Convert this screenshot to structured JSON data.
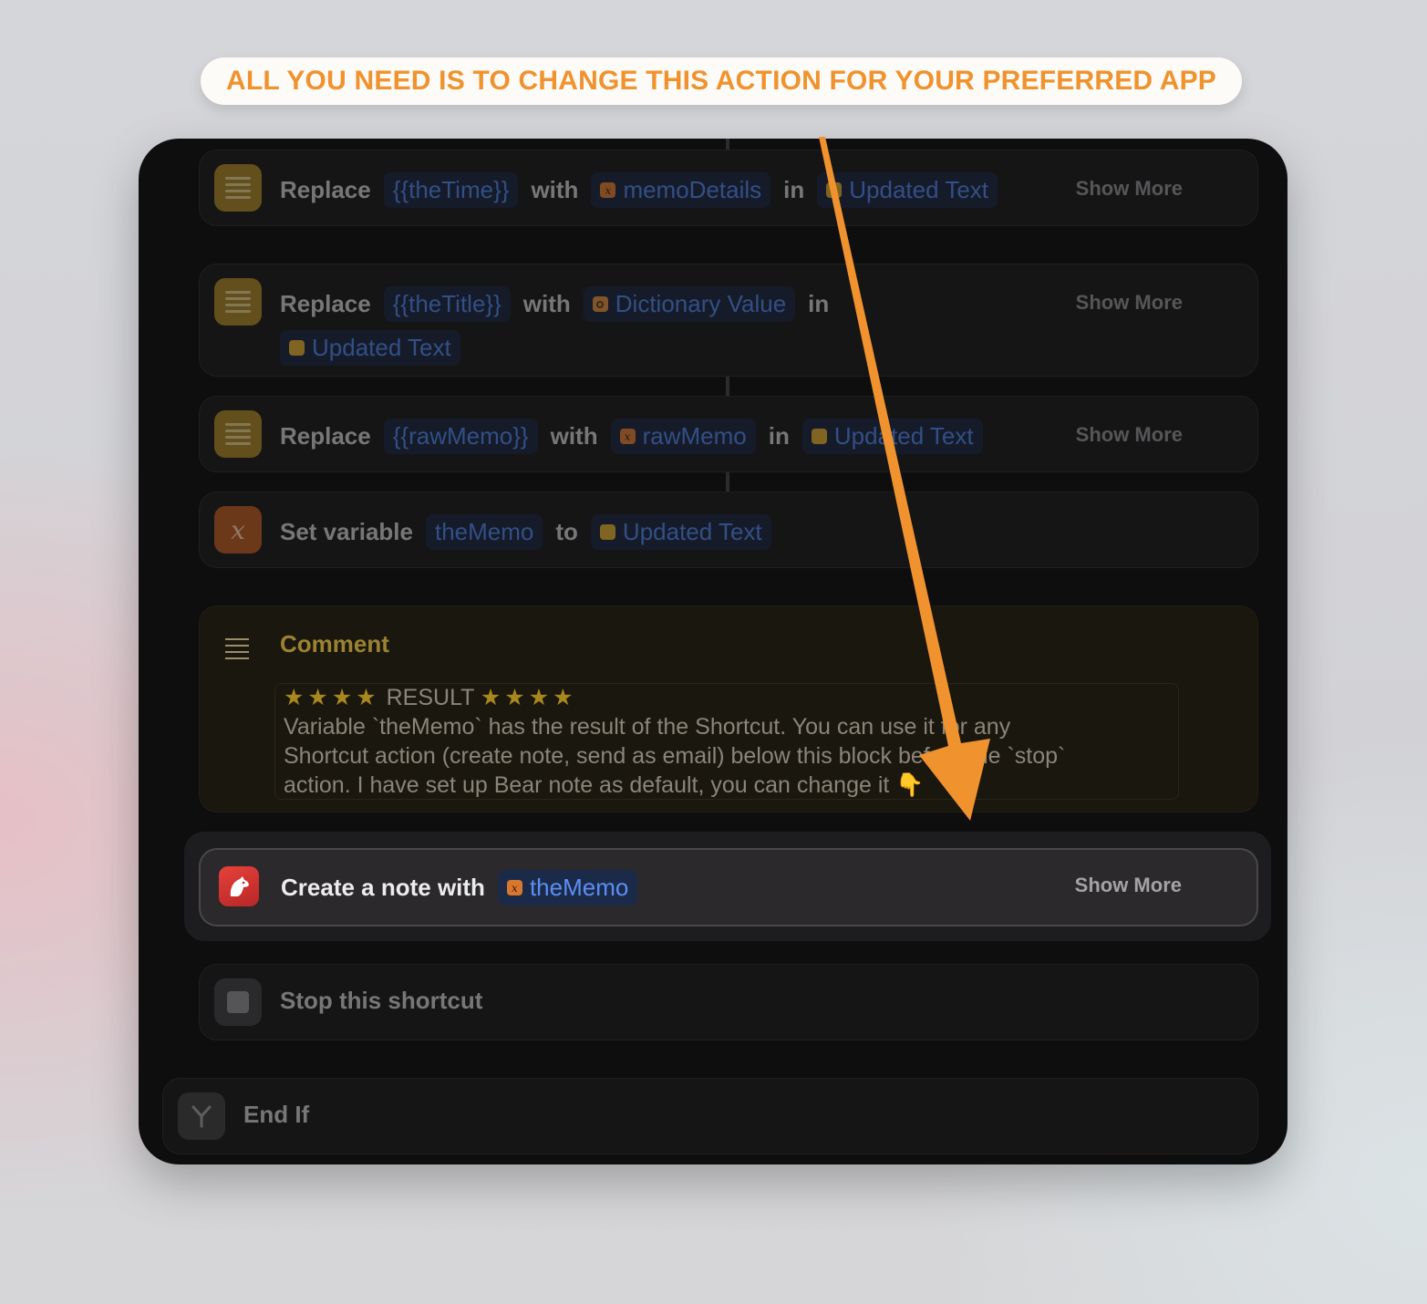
{
  "banner": {
    "text": "ALL YOU NEED IS TO CHANGE THIS ACTION FOR YOUR PREFERRED APP"
  },
  "actions": [
    {
      "verb": "Replace",
      "find": "{{theTime}}",
      "with": "with",
      "value": "memoDetails",
      "in": "in",
      "target": "Updated Text",
      "show_more": "Show More"
    },
    {
      "verb": "Replace",
      "find": "{{theTitle}}",
      "with": "with",
      "value": "Dictionary Value",
      "in": "in",
      "target": "Updated Text",
      "show_more": "Show More"
    },
    {
      "verb": "Replace",
      "find": "{{rawMemo}}",
      "with": "with",
      "value": "rawMemo",
      "in": "in",
      "target": "Updated Text",
      "show_more": "Show More"
    },
    {
      "verb": "Set variable",
      "variable": "theMemo",
      "to": "to",
      "target": "Updated Text"
    }
  ],
  "comment": {
    "title": "Comment",
    "stars_left": "★★★★",
    "result_label": "RESULT",
    "stars_right": "★★★★",
    "line1": "Variable `theMemo` has the result of the Shortcut. You can use it for any",
    "line2": "Shortcut action (create note, send as email) below this block before the `stop`",
    "line3": "action. I have set up  Bear note as default, you can change it 👇"
  },
  "selected_action": {
    "label": "Create a note with",
    "token": "theMemo",
    "show_more": "Show More"
  },
  "stop_action": {
    "label": "Stop this shortcut"
  },
  "end_if": {
    "label": "End If"
  },
  "colors": {
    "accent_orange": "#f0922e",
    "token_blue": "#4a7fe3",
    "panel_bg": "#0e0e0f"
  },
  "icons": [
    "text-icon",
    "variable-icon",
    "comment-icon",
    "bear-app-icon",
    "stop-icon",
    "branch-icon"
  ]
}
